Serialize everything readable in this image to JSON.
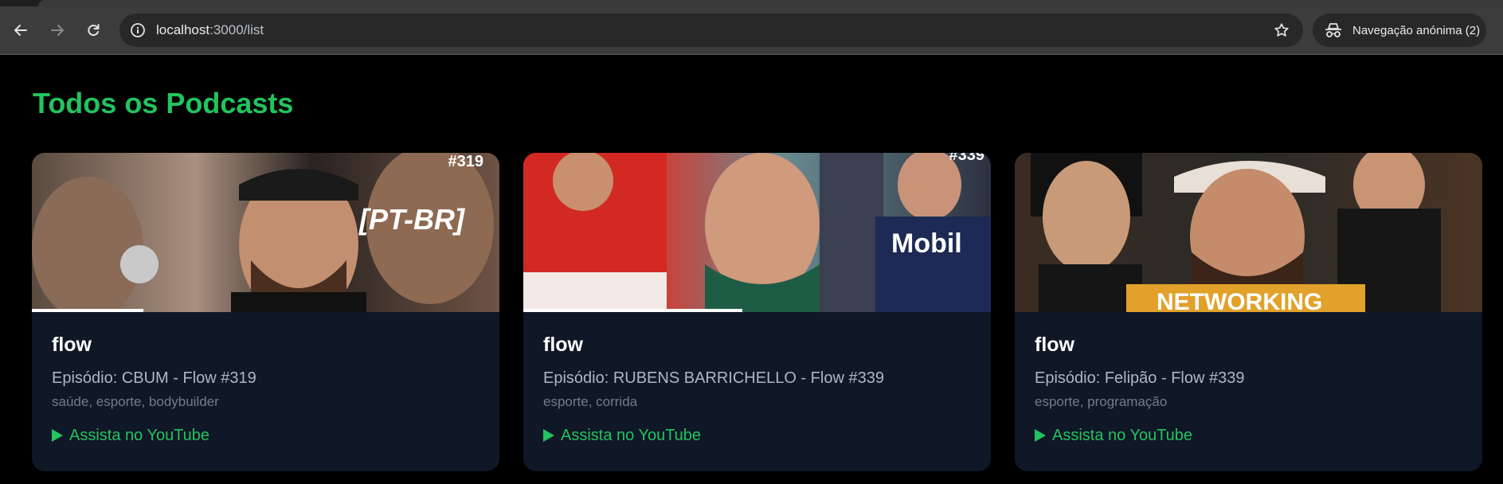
{
  "browser": {
    "address": {
      "host": "localhost",
      "path": ":3000/list"
    },
    "incognito_label": "Navegação anónima (2)",
    "icons": {
      "back": "arrow-left-icon",
      "forward": "arrow-right-icon",
      "reload": "reload-icon",
      "site_info": "info-icon",
      "bookmark": "star-icon",
      "incognito": "incognito-icon"
    }
  },
  "page": {
    "title": "Todos os Podcasts",
    "accent_color": "#21c45e",
    "card_bg": "#101726"
  },
  "podcasts": [
    {
      "channel": "flow",
      "episode": "Episódio: CBUM - Flow #319",
      "tags": "saúde, esporte, bodybuilder",
      "link_label": "Assista no YouTube",
      "thumb_text": "[PT-BR]",
      "thumb_badge": "#319"
    },
    {
      "channel": "flow",
      "episode": "Episódio: RUBENS BARRICHELLO - Flow #339",
      "tags": "esporte, corrida",
      "link_label": "Assista no YouTube",
      "thumb_text": "Mobil",
      "thumb_badge": "#339"
    },
    {
      "channel": "flow",
      "episode": "Episódio: Felipão - Flow #339",
      "tags": "esporte, programação",
      "link_label": "Assista no YouTube",
      "thumb_text": "NETWORKING",
      "thumb_badge": ""
    }
  ]
}
